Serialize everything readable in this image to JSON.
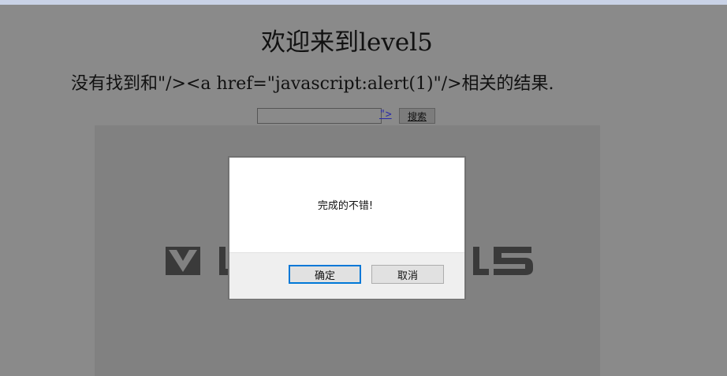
{
  "page": {
    "heading": "欢迎来到level5",
    "result_text": "没有找到和\"/><a href=\"javascript:alert(1)\"/>相关的结果."
  },
  "search": {
    "input_value": "",
    "injected_link_text": "\">",
    "button_label": "搜索"
  },
  "banner": {
    "logo_text": "LEVEL5"
  },
  "dialog": {
    "message": "完成的不错!",
    "ok_label": "确定",
    "cancel_label": "取消"
  },
  "colors": {
    "overlay_background": "#8a8a8a",
    "dialog_background": "#ffffff",
    "focus_border": "#0078d7"
  }
}
